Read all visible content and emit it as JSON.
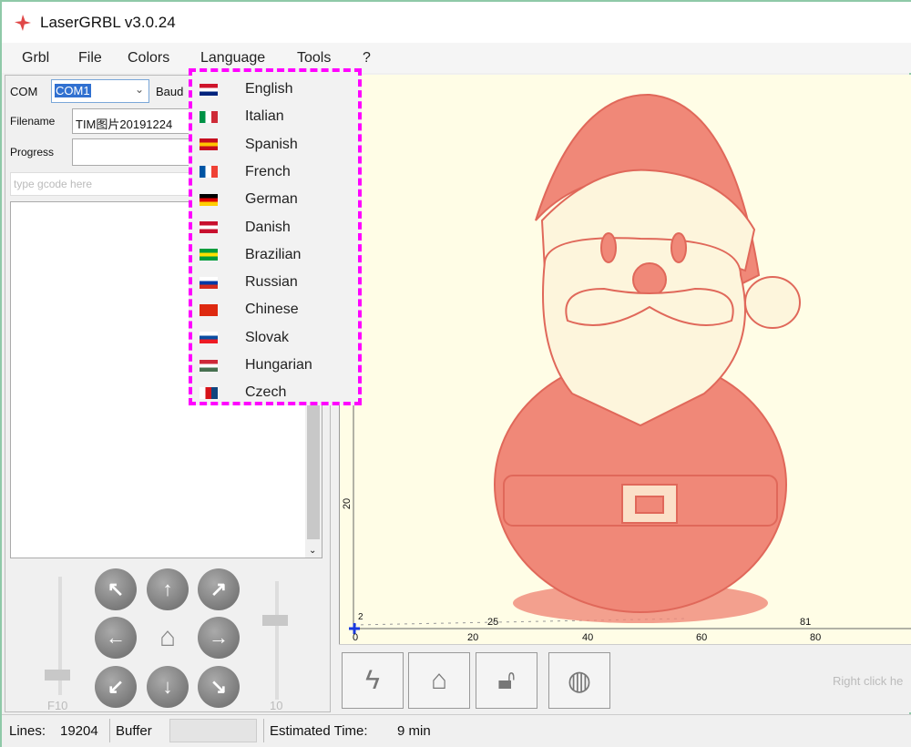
{
  "window": {
    "title": "LaserGRBL v3.0.24"
  },
  "menu": [
    "Grbl",
    "File",
    "Colors",
    "Language",
    "Tools",
    "?"
  ],
  "left": {
    "com_label": "COM",
    "com_value": "COM1",
    "baud_label": "Baud",
    "filename_label": "Filename",
    "filename_value": "TIM图片20191224",
    "progress_label": "Progress",
    "gcode_placeholder": "type gcode here",
    "speed_label": "F10",
    "step_label": "10"
  },
  "language_menu": [
    {
      "label": "English",
      "flag": [
        "#cf142b",
        "#fff",
        "#00247d"
      ]
    },
    {
      "label": "Italian",
      "flag": [
        "#009246",
        "#fff",
        "#ce2b37"
      ]
    },
    {
      "label": "Spanish",
      "flag": [
        "#c60b1e",
        "#ffc400",
        "#c60b1e"
      ]
    },
    {
      "label": "French",
      "flag": [
        "#0055a4",
        "#fff",
        "#ef4135"
      ]
    },
    {
      "label": "German",
      "flag": [
        "#000",
        "#dd0000",
        "#ffce00"
      ]
    },
    {
      "label": "Danish",
      "flag": [
        "#c8102e",
        "#fff",
        "#c8102e"
      ]
    },
    {
      "label": "Brazilian",
      "flag": [
        "#009c3b",
        "#ffdf00",
        "#009c3b"
      ]
    },
    {
      "label": "Russian",
      "flag": [
        "#fff",
        "#0039a6",
        "#d52b1e"
      ]
    },
    {
      "label": "Chinese",
      "flag": [
        "#de2910",
        "#de2910",
        "#de2910"
      ]
    },
    {
      "label": "Slovak",
      "flag": [
        "#fff",
        "#0b4ea2",
        "#ee1c25"
      ]
    },
    {
      "label": "Hungarian",
      "flag": [
        "#ce2939",
        "#fff",
        "#477050"
      ]
    },
    {
      "label": "Czech",
      "flag": [
        "#fff",
        "#d7141a",
        "#11457e"
      ]
    }
  ],
  "canvas": {
    "x_ticks": [
      "0",
      "20",
      "40",
      "60",
      "80"
    ],
    "y_ticks": [
      "20"
    ],
    "annotations": [
      "2",
      "25",
      "81"
    ],
    "hint": "Right click he"
  },
  "status": {
    "lines_label": "Lines:",
    "lines_value": "19204",
    "buffer_label": "Buffer",
    "time_label": "Estimated Time:",
    "time_value": "9 min"
  }
}
